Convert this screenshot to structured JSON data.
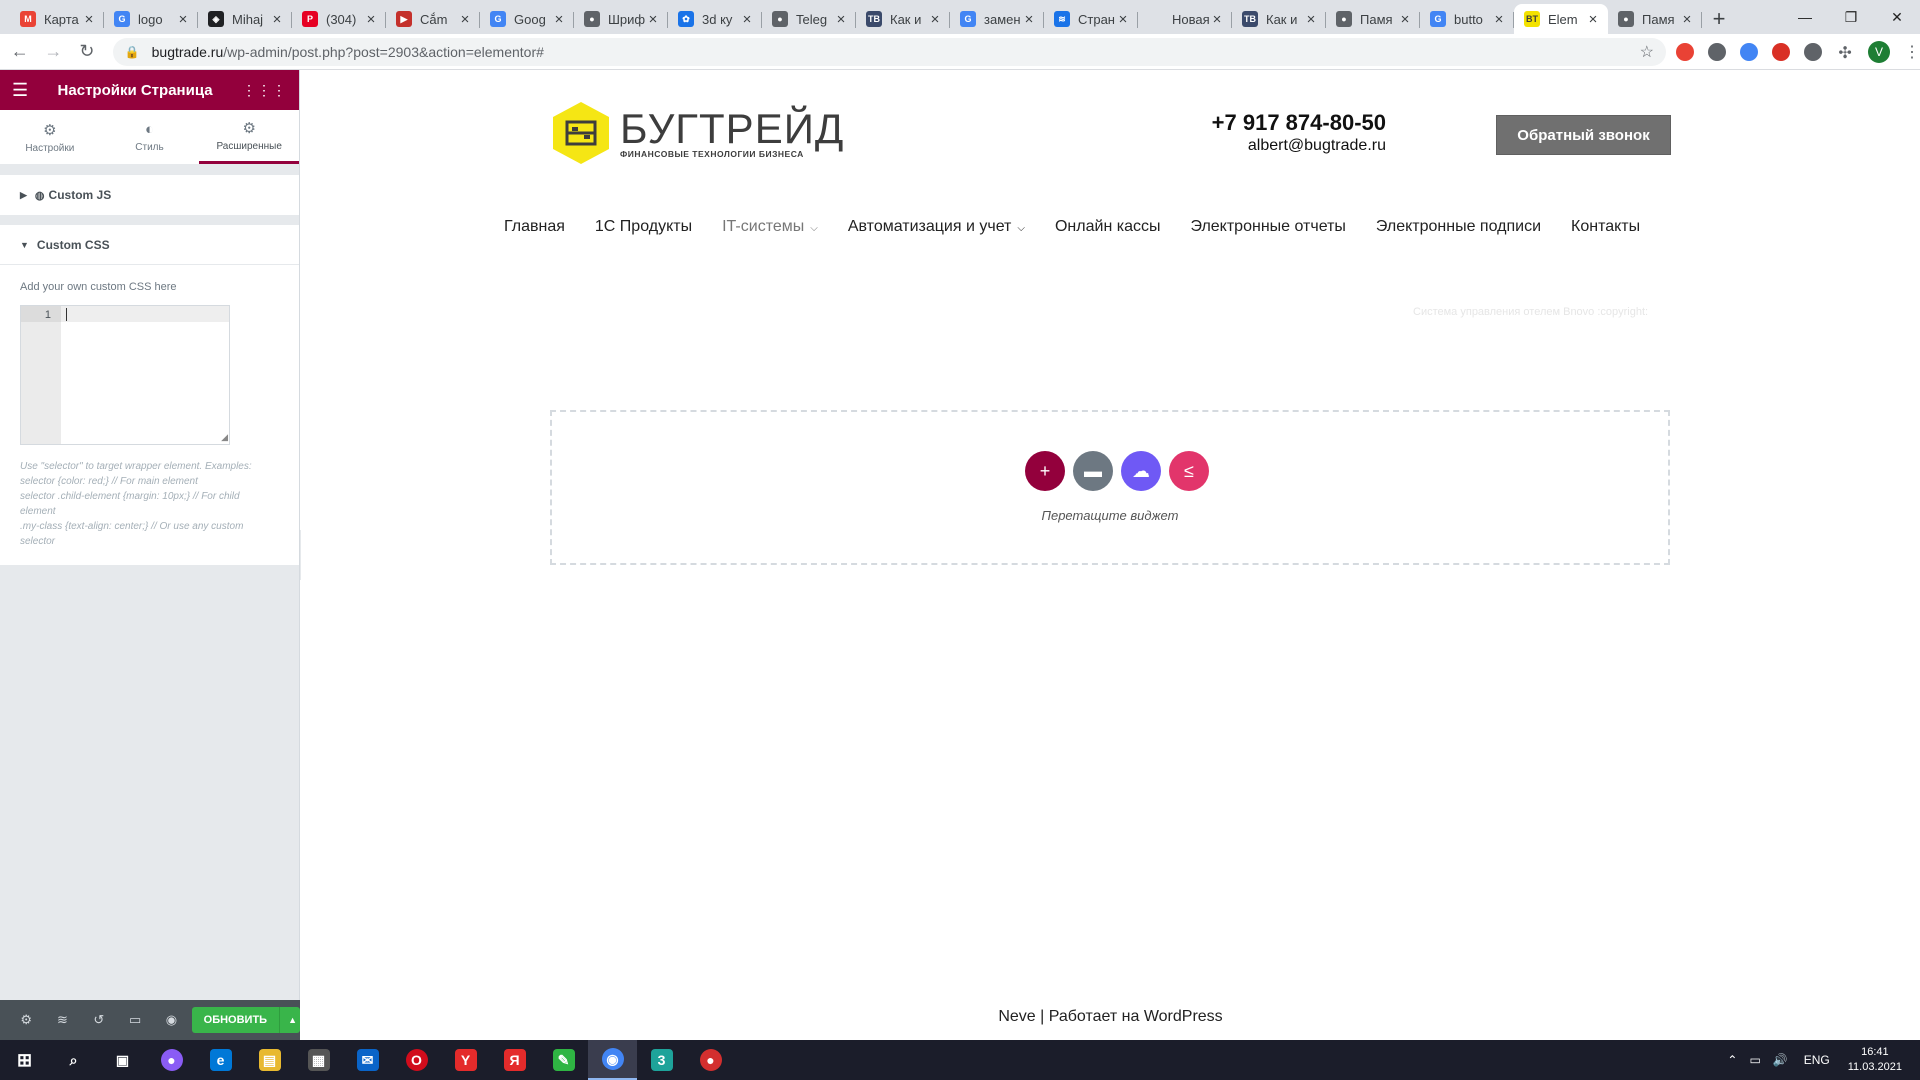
{
  "browser": {
    "tabs": [
      {
        "title": "Карта",
        "fav_color": "#ea4335",
        "fav_char": "M"
      },
      {
        "title": "logo",
        "fav_color": "#4285f4",
        "fav_char": "G"
      },
      {
        "title": "Mihaj",
        "fav_color": "#202124",
        "fav_char": "◈"
      },
      {
        "title": "(304)",
        "fav_color": "#e60023",
        "fav_char": "P"
      },
      {
        "title": "Cắm",
        "fav_color": "#c4302b",
        "fav_char": "▶"
      },
      {
        "title": "Goog",
        "fav_color": "#4285f4",
        "fav_char": "G"
      },
      {
        "title": "Шриф",
        "fav_color": "#5f6368",
        "fav_char": "●"
      },
      {
        "title": "3d ку",
        "fav_color": "#1a73e8",
        "fav_char": "✿"
      },
      {
        "title": "Teleg",
        "fav_color": "#5f6368",
        "fav_char": "●"
      },
      {
        "title": "Как и",
        "fav_color": "#3b4a6b",
        "fav_char": "TB"
      },
      {
        "title": "замен",
        "fav_color": "#4285f4",
        "fav_char": "G"
      },
      {
        "title": "Стран",
        "fav_color": "#1a73e8",
        "fav_char": "≋"
      },
      {
        "title": "Новая вкл",
        "fav_color": "#dee1e6",
        "fav_char": ""
      },
      {
        "title": "Как и",
        "fav_color": "#3b4a6b",
        "fav_char": "TB"
      },
      {
        "title": "Памя",
        "fav_color": "#5f6368",
        "fav_char": "●"
      },
      {
        "title": "butto",
        "fav_color": "#4285f4",
        "fav_char": "G"
      },
      {
        "title": "Elem",
        "fav_color": "#f3e200",
        "fav_char": "BT",
        "active": true
      },
      {
        "title": "Памя",
        "fav_color": "#5f6368",
        "fav_char": "●"
      }
    ],
    "new_tab": "+",
    "window_controls": {
      "minimize": "—",
      "maximize": "❐",
      "close": "✕"
    },
    "nav": {
      "back": "←",
      "forward": "→",
      "reload": "↻"
    },
    "url_host": "bugtrade.ru",
    "url_path": "/wp-admin/post.php?post=2903&action=elementor#",
    "lock_icon": "🔒",
    "star_icon": "☆",
    "extension_colors": [
      "#e94235",
      "#5f6368",
      "#4285f4",
      "#d93025",
      "#5f6368"
    ],
    "profile_initial": "V"
  },
  "panel": {
    "menu_icon": "☰",
    "apps_icon": "⋮⋮⋮",
    "title": "Настройки Страница",
    "tabs": [
      {
        "label": "Настройки",
        "icon": "⚙"
      },
      {
        "label": "Стиль",
        "icon": "◐"
      },
      {
        "label": "Расширенные",
        "icon": "⚙"
      }
    ],
    "custom_js": {
      "label": "Custom JS",
      "caret": "▶",
      "icon": "◍"
    },
    "custom_css": {
      "label": "Custom CSS",
      "caret": "▼",
      "hint": "Add your own custom CSS here",
      "line_number": "1",
      "resize_glyph": "◢",
      "note_lines": [
        "Use \"selector\" to target wrapper element. Examples:",
        "selector {color: red;} // For main element",
        "selector .child-element {margin: 10px;} // For child",
        "element",
        ".my-class {text-align: center;} // Or use any custom",
        "selector"
      ]
    },
    "collapse_icon": "‹",
    "footer": {
      "icons": [
        "⚙",
        "≋",
        "↺",
        "▭",
        "◉"
      ],
      "publish_label": "ОБНОВИТЬ",
      "publish_arrow": "▲"
    }
  },
  "site": {
    "logo_text": "БУГТРЕЙД",
    "logo_subtitle": "ФИНАНСОВЫЕ ТЕХНОЛОГИИ БИЗНЕСА",
    "logo_colors": {
      "hex": "#f5e614",
      "text": "#3d3d3d"
    },
    "phone": "+7 917 874-80-50",
    "email": "albert@bugtrade.ru",
    "callback_button": "Обратный звонок",
    "menu": [
      {
        "label": "Главная"
      },
      {
        "label": "1С Продукты"
      },
      {
        "label": "IT-системы",
        "muted": true,
        "dropdown": "⌵"
      },
      {
        "label": "Автоматизация и учет",
        "dropdown": "⌵"
      },
      {
        "label": "Онлайн кассы"
      },
      {
        "label": "Электронные отчеты"
      },
      {
        "label": "Электронные подписи"
      },
      {
        "label": "Контакты"
      }
    ],
    "faint_text": "Система управления отелем Bnovo :copyright:",
    "dropzone": {
      "buttons": [
        {
          "name": "add-section-button",
          "symbol": "+",
          "color": "#93003c"
        },
        {
          "name": "add-template-button",
          "symbol": "▬",
          "color": "#6d7882"
        },
        {
          "name": "cloud-templates-button",
          "symbol": "☁",
          "color": "#6f59f5"
        },
        {
          "name": "envato-kit-button",
          "symbol": "≤",
          "color": "#e2356b"
        }
      ],
      "text": "Перетащите виджет"
    },
    "footer_text": "Neve | Работает на WordPress"
  },
  "taskbar": {
    "start_icon": "⊞",
    "apps": [
      {
        "name": "search",
        "symbol": "⌕",
        "color": "transparent"
      },
      {
        "name": "task-view",
        "symbol": "▣",
        "color": "transparent"
      },
      {
        "name": "alice",
        "symbol": "●",
        "color": "#8a5cf5"
      },
      {
        "name": "edge",
        "symbol": "e",
        "color": "#0078d7"
      },
      {
        "name": "explorer",
        "symbol": "▤",
        "color": "#e8b930"
      },
      {
        "name": "store",
        "symbol": "▦",
        "color": "#555"
      },
      {
        "name": "mail",
        "symbol": "✉",
        "color": "#0a64c8"
      },
      {
        "name": "opera",
        "symbol": "O",
        "color": "#d10c1c"
      },
      {
        "name": "yandex-browser",
        "symbol": "Y",
        "color": "#e42b2b"
      },
      {
        "name": "yandex",
        "symbol": "Я",
        "color": "#e42b2b"
      },
      {
        "name": "app-green",
        "symbol": "✎",
        "color": "#2fb543"
      },
      {
        "name": "chrome",
        "symbol": "◉",
        "color": "#4285f4",
        "active": true
      },
      {
        "name": "app-3",
        "symbol": "3",
        "color": "#1ea39a"
      },
      {
        "name": "app-red",
        "symbol": "●",
        "color": "#d32f2f"
      }
    ],
    "tray_icons": [
      "⌃",
      "▭",
      "🔊"
    ],
    "language": "ENG",
    "time": "16:41",
    "date": "11.03.2021"
  }
}
